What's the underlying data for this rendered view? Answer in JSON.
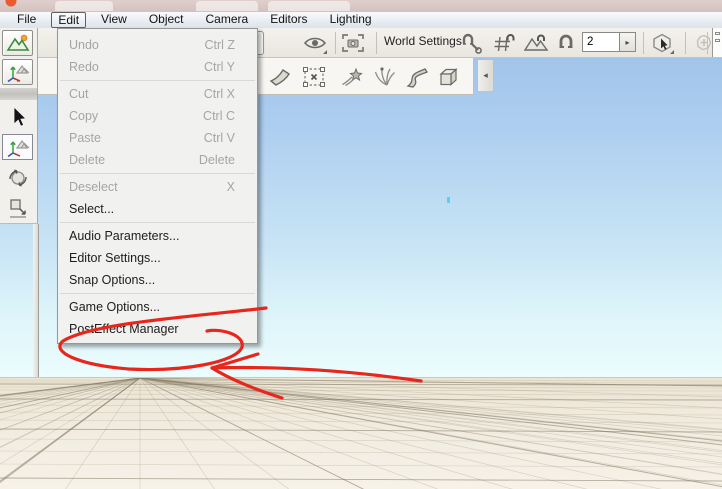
{
  "menubar": {
    "items": [
      "File",
      "Edit",
      "View",
      "Object",
      "Camera",
      "Editors",
      "Lighting"
    ],
    "active_item": "Edit"
  },
  "edit_menu": {
    "items": [
      {
        "label": "Undo",
        "shortcut": "Ctrl Z",
        "enabled": false
      },
      {
        "label": "Redo",
        "shortcut": "Ctrl Y",
        "enabled": false
      },
      {
        "label": "Cut",
        "shortcut": "Ctrl X",
        "enabled": false
      },
      {
        "label": "Copy",
        "shortcut": "Ctrl C",
        "enabled": false
      },
      {
        "label": "Paste",
        "shortcut": "Ctrl V",
        "enabled": false
      },
      {
        "label": "Delete",
        "shortcut": "Delete",
        "enabled": false
      },
      {
        "label": "Deselect",
        "shortcut": "X",
        "enabled": false
      },
      {
        "label": "Select...",
        "shortcut": "",
        "enabled": true
      },
      {
        "label": "Audio Parameters...",
        "shortcut": "",
        "enabled": true
      },
      {
        "label": "Editor Settings...",
        "shortcut": "",
        "enabled": true
      },
      {
        "label": "Snap Options...",
        "shortcut": "",
        "enabled": true
      },
      {
        "label": "Game Options...",
        "shortcut": "",
        "enabled": true
      },
      {
        "label": "PostEffect Manager",
        "shortcut": "",
        "enabled": true
      }
    ]
  },
  "toolbar_main": {
    "world_settings_label": "World Settings",
    "snap_size_value": "2",
    "spinner_arrow": "▸",
    "icons": [
      "visibility-eye",
      "camera-snapshot",
      "snap-to-object",
      "snap-to-grid",
      "snap-to-terrain",
      "soft-snap-magnet",
      "object-select-cursor",
      "add-object",
      "move-to-terrain"
    ]
  },
  "toolbar_secondary": {
    "scroll_arrow": "◂",
    "icons": [
      "ramp-tool",
      "selection-marquee",
      "comet-emitter",
      "particle-fountain",
      "river-road-tool",
      "convex-shape"
    ]
  },
  "tool_palette": {
    "icons": [
      "terrain-scene",
      "world-editor-axes",
      "arrow-select",
      "world-editor-axes-selected",
      "rotate-tool",
      "scale-tool"
    ]
  },
  "viewport": {
    "sky_top_color": "#9dc0e6",
    "sky_horizon_color": "#ebfcfd",
    "ground_color": "#efe8da"
  },
  "annotation": {
    "color": "#e8261c",
    "shapes": [
      "hand-drawn-ellipse",
      "hand-drawn-arrow",
      "orange-dot"
    ],
    "target": "PostEffect Manager"
  }
}
